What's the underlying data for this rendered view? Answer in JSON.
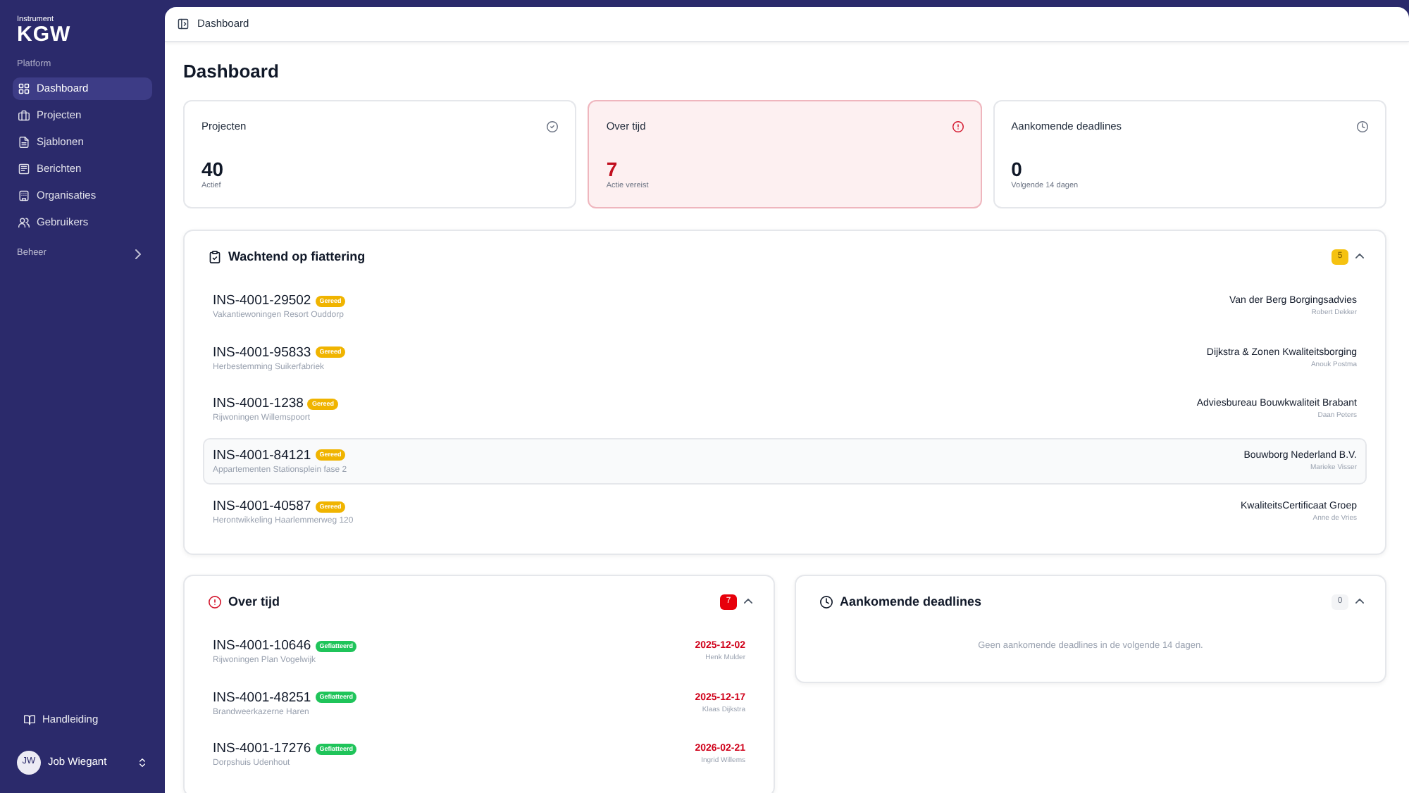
{
  "sidebar": {
    "logo": {
      "small": "Instrument",
      "main": "KGW"
    },
    "section_label": "Platform",
    "items": [
      {
        "label": "Dashboard",
        "selected": true
      },
      {
        "label": "Projecten",
        "selected": false
      },
      {
        "label": "Sjablonen",
        "selected": false
      },
      {
        "label": "Berichten",
        "selected": false
      },
      {
        "label": "Organisaties",
        "selected": false
      },
      {
        "label": "Gebruikers",
        "selected": false
      }
    ],
    "group": {
      "label": "Beheer",
      "expanded": false
    },
    "footer_link": "Handleiding",
    "user": {
      "initials": "JW",
      "name": "Job Wiegant"
    }
  },
  "header": {
    "breadcrumb": "Dashboard"
  },
  "page_title": "Dashboard",
  "stats": [
    {
      "kind": "projects",
      "title": "Projecten",
      "value": "40",
      "caption": "Actief"
    },
    {
      "kind": "overdue",
      "title": "Over tijd",
      "value": "7",
      "caption": "Actie vereist"
    },
    {
      "kind": "upcoming",
      "title": "Aankomende deadlines",
      "value": "0",
      "caption": "Volgende 14 dagen"
    }
  ],
  "sections": [
    {
      "kind": "pending",
      "title": "Wachtend op fiattering",
      "count": "5",
      "expanded": true,
      "items": [
        {
          "code": "INS-4001-29502",
          "badge": {
            "label": "Gereed",
            "color": "#f0b400"
          },
          "project": "Vakantiewoningen Resort Ouddorp",
          "organisation": "Van der Berg Borgingsadvies",
          "person": "Robert Dekker",
          "selected": false
        },
        {
          "code": "INS-4001-95833",
          "badge": {
            "label": "Gereed",
            "color": "#f0b400"
          },
          "project": "Herbestemming Suikerfabriek",
          "organisation": "Dijkstra & Zonen Kwaliteitsborging",
          "person": "Anouk Postma",
          "selected": false
        },
        {
          "code": "INS-4001-1238",
          "badge": {
            "label": "Gereed",
            "color": "#f0b400"
          },
          "project": "Rijwoningen Willemspoort",
          "organisation": "Adviesbureau Bouwkwaliteit Brabant",
          "person": "Daan Peters",
          "selected": false
        },
        {
          "code": "INS-4001-84121",
          "badge": {
            "label": "Gereed",
            "color": "#f0b400"
          },
          "project": "Appartementen Stationsplein fase 2",
          "organisation": "Bouwborg Nederland B.V.",
          "person": "Marieke Visser",
          "selected": true
        },
        {
          "code": "INS-4001-40587",
          "badge": {
            "label": "Gereed",
            "color": "#f0b400"
          },
          "project": "Herontwikkeling Haarlemmerweg 120",
          "organisation": "KwaliteitsCertificaat Groep",
          "person": "Anne de Vries",
          "selected": false
        }
      ]
    },
    {
      "kind": "overdue",
      "title": "Over tijd",
      "count": "7",
      "expanded": true,
      "items": [
        {
          "code": "INS-4001-10646",
          "badge": {
            "label": "Gefiatteerd",
            "color": "#1fc45a"
          },
          "project": "Rijwoningen Plan Vogelwijk",
          "deadline": "2025-12-02",
          "person": "Henk Mulder",
          "selected": false
        },
        {
          "code": "INS-4001-48251",
          "badge": {
            "label": "Gefiatteerd",
            "color": "#1fc45a"
          },
          "project": "Brandweerkazerne Haren",
          "deadline": "2025-12-17",
          "person": "Klaas Dijkstra",
          "selected": false
        },
        {
          "code": "INS-4001-17276",
          "badge": {
            "label": "Gefiatteerd",
            "color": "#1fc45a"
          },
          "project": "Dorpshuis Udenhout",
          "deadline": "2026-02-21",
          "person": "Ingrid Willems",
          "selected": false
        }
      ]
    },
    {
      "kind": "upcoming",
      "title": "Aankomende deadlines",
      "count": "0",
      "expanded": true,
      "empty_message": "Geen aankomende deadlines in de volgende 14 dagen."
    }
  ]
}
